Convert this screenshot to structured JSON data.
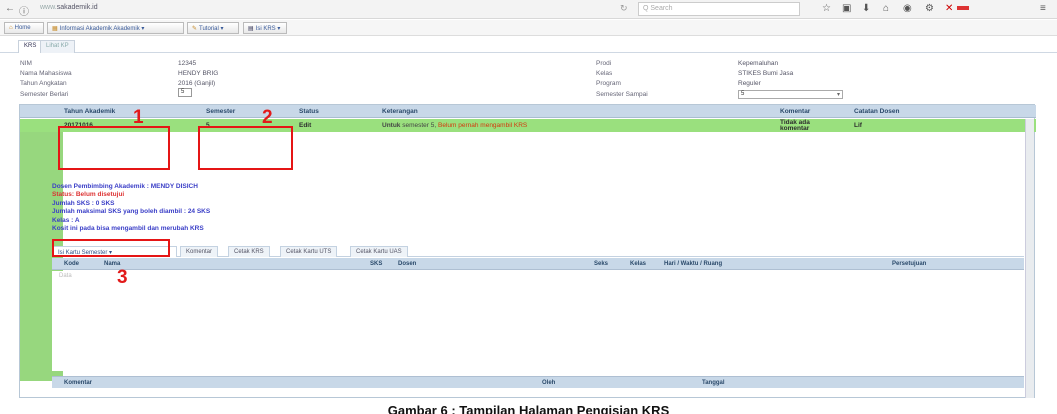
{
  "browser": {
    "url_host": "www.",
    "url_rest": "sakademik.id",
    "search_placeholder": "Q Search"
  },
  "bookmarks": [
    {
      "label": "Home",
      "icon": "home-icon"
    },
    {
      "label": "Informasi Akademik Akademik",
      "icon": "folder-icon"
    },
    {
      "label": "Tutorial",
      "icon": "pencil-icon"
    },
    {
      "label": "Isi KRS",
      "icon": "doc-icon"
    }
  ],
  "subtabs": [
    "KRS",
    "Lihat KP"
  ],
  "student": {
    "left_labels": [
      "NIM",
      "Nama Mahasiswa",
      "Tahun Angkatan",
      "Semester Berlari"
    ],
    "left_values": [
      "12345",
      "HENDY BRIG",
      "2016 (Ganjil)",
      "5"
    ],
    "right_labels": [
      "Prodi",
      "Kelas",
      "Program",
      "Semester Sampai"
    ],
    "right_values": [
      "Kepemaluhan",
      "STIKES Bumi Jasa",
      "Reguler",
      "5"
    ]
  },
  "grid": {
    "headers": [
      "Tahun Akademik",
      "Semester",
      "Status",
      "Keterangan",
      "Komentar",
      "Catatan Dosen"
    ],
    "row": {
      "tahun": "20171016",
      "semester": "5",
      "status": "Edit",
      "keterangan_a": "Untuk",
      "keterangan_b": "semester 5,",
      "keterangan_c": "Belum pernah mengambil KRS",
      "komentar_l1": "Tidak ada",
      "komentar_l2": "komentar",
      "catatan": "Lif"
    }
  },
  "detail": {
    "line1": "Dosen Pembimbing Akademik : MENDY DISICH",
    "line2": "Status: Belum disetujui",
    "line3": "Jumlah SKS : 0 SKS",
    "line4": "Jumlah maksimal SKS yang boleh diambil : 24 SKS",
    "line5": "Kelas : A",
    "line6": "Kosit ini pada bisa mengambil dan merubah KRS"
  },
  "bottom_tabs": [
    "Isi Kartu Semester",
    "Komentar",
    "Cetak KRS",
    "Cetak Kartu UTS",
    "Cetak Kartu UAS"
  ],
  "inner_headers": [
    "Kode",
    "Nama",
    "SKS",
    "Dosen",
    "Seks",
    "Kelas",
    "Hari / Waktu / Ruang",
    "Persetujuan"
  ],
  "inner_empty": "Data",
  "footer_headers": [
    "Komentar",
    "Oleh",
    "Tanggal"
  ],
  "annotations": [
    "1",
    "2",
    "3"
  ],
  "caption": "Gambar 6 : Tampilan Halaman Pengisian KRS"
}
